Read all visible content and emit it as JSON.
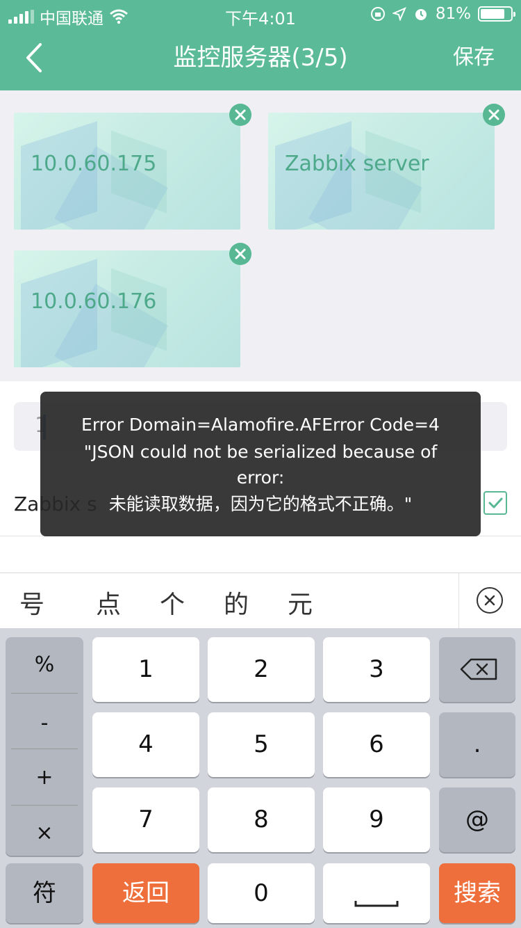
{
  "status_bar": {
    "carrier": "中国联通",
    "time": "下午4:01",
    "battery": "81%",
    "battery_level": 0.81
  },
  "nav": {
    "title": "监控服务器(3/5)",
    "save": "保存"
  },
  "cards": [
    {
      "label": "10.0.60.175"
    },
    {
      "label": "Zabbix server"
    },
    {
      "label": "10.0.60.176"
    }
  ],
  "list": {
    "row_label": "Zabbix s",
    "search_value": "1"
  },
  "toast": {
    "line1": "Error Domain=Alamofire.AFError Code=4",
    "line2": "\"JSON could not be serialized because of",
    "line3": "error:",
    "line4": "未能读取数据，因为它的格式不正确。\""
  },
  "suggestions": [
    "号",
    "点",
    "个",
    "的",
    "元"
  ],
  "keyboard": {
    "symbols": [
      "%",
      "-",
      "+",
      "×"
    ],
    "digits": [
      "1",
      "2",
      "3",
      "4",
      "5",
      "6",
      "7",
      "8",
      "9"
    ],
    "right_keys": [
      ".",
      "@"
    ],
    "symbol_key": "符",
    "back_key": "返回",
    "zero_key": "0",
    "search_key": "搜索"
  },
  "colors": {
    "brand_green": "#5bbb98",
    "orange": "#ee6f3b"
  }
}
